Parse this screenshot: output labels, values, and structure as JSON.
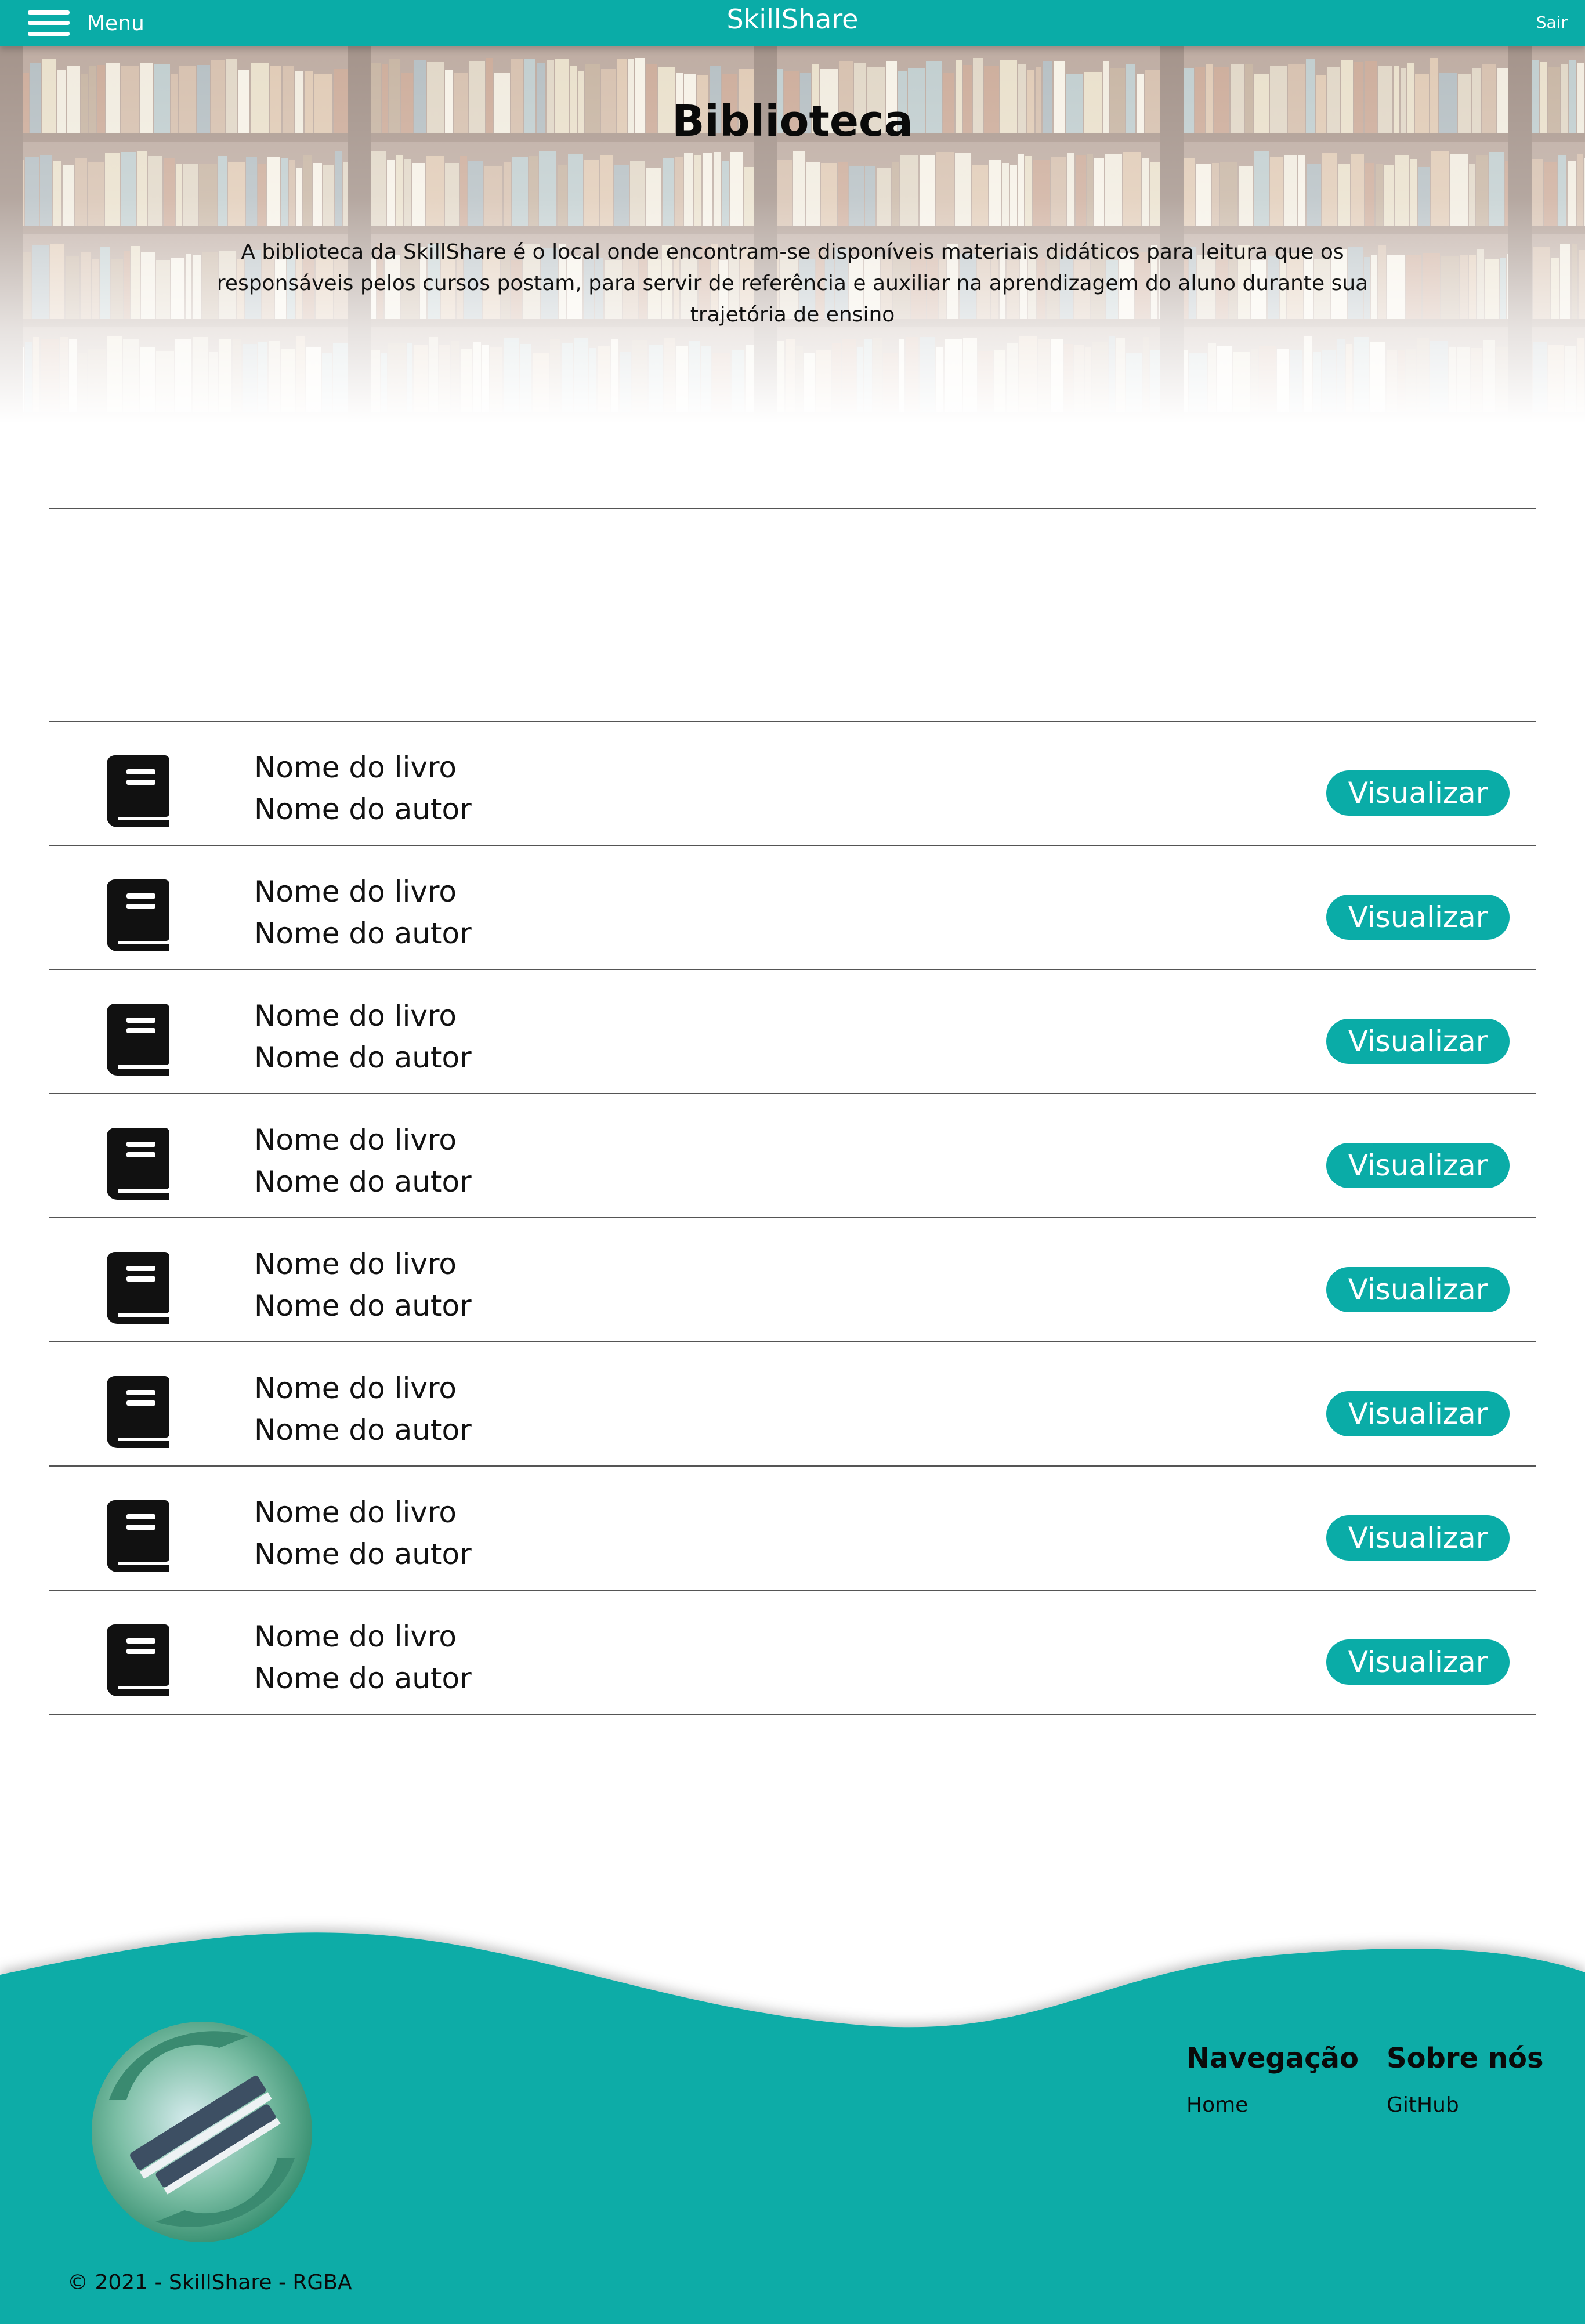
{
  "colors": {
    "accent": "#0aaca7",
    "text": "#111111"
  },
  "nav": {
    "menu_label": "Menu",
    "brand": "SkillShare",
    "logout_label": "Sair"
  },
  "hero": {
    "title": "Biblioteca",
    "description": "A biblioteca da SkillShare é o local onde encontram-se disponíveis materiais didáticos para leitura que os responsáveis pelos cursos postam, para servir de referência e auxiliar na aprendizagem do aluno durante sua trajetória de ensino"
  },
  "books": [
    {
      "title": "Nome do livro",
      "author": "Nome do autor",
      "action": "Visualizar",
      "icon": "book-icon"
    },
    {
      "title": "Nome do livro",
      "author": "Nome do autor",
      "action": "Visualizar",
      "icon": "book-icon"
    },
    {
      "title": "Nome do livro",
      "author": "Nome do autor",
      "action": "Visualizar",
      "icon": "book-icon"
    },
    {
      "title": "Nome do livro",
      "author": "Nome do autor",
      "action": "Visualizar",
      "icon": "book-icon"
    },
    {
      "title": "Nome do livro",
      "author": "Nome do autor",
      "action": "Visualizar",
      "icon": "book-icon"
    },
    {
      "title": "Nome do livro",
      "author": "Nome do autor",
      "action": "Visualizar",
      "icon": "book-icon"
    },
    {
      "title": "Nome do livro",
      "author": "Nome do autor",
      "action": "Visualizar",
      "icon": "book-icon"
    },
    {
      "title": "Nome do livro",
      "author": "Nome do autor",
      "action": "Visualizar",
      "icon": "book-icon"
    }
  ],
  "footer": {
    "nav_title": "Navegação",
    "nav_link": "Home",
    "about_title": "Sobre nós",
    "about_link": "GitHub",
    "copyright": "© 2021 - SkillShare - RGBA"
  }
}
